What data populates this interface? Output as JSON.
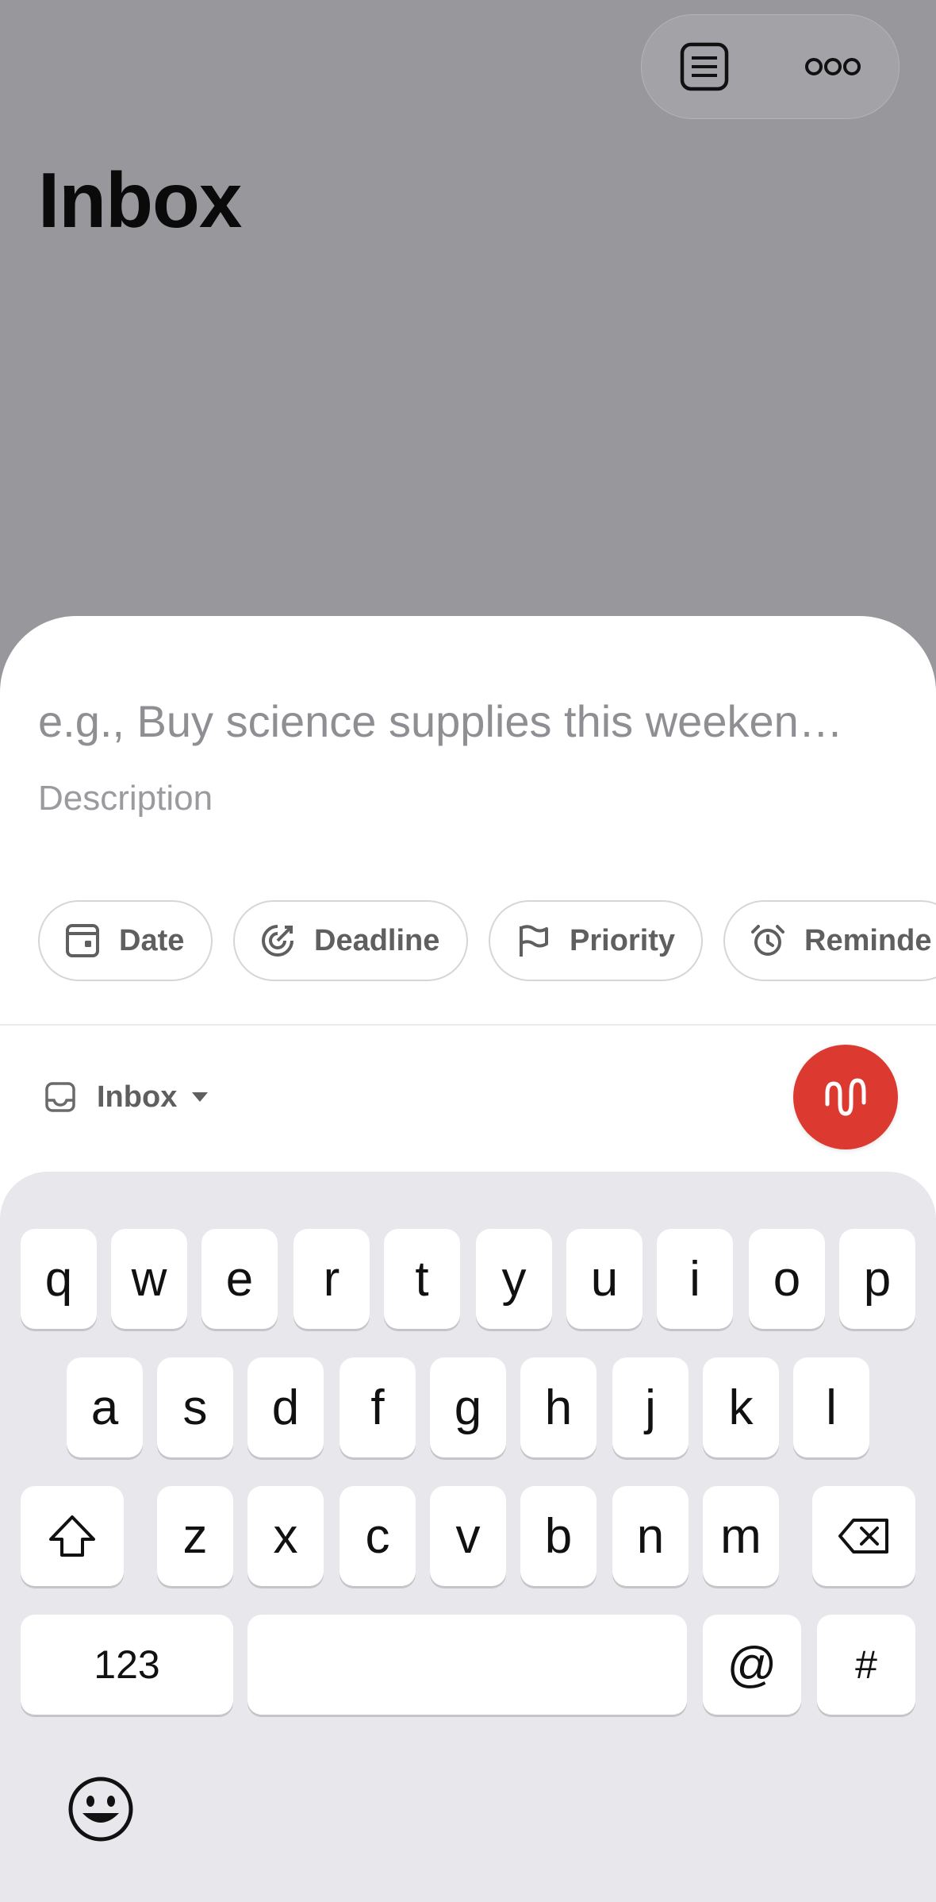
{
  "header": {
    "title": "Inbox",
    "list_icon": "list-view-icon",
    "more_icon": "more-dots-icon"
  },
  "task_form": {
    "title_placeholder": "e.g., Buy science supplies this weeken…",
    "description_placeholder": "Description",
    "chips": [
      {
        "label": "Date",
        "icon": "calendar-icon"
      },
      {
        "label": "Deadline",
        "icon": "deadline-target-icon"
      },
      {
        "label": "Priority",
        "icon": "flag-icon"
      },
      {
        "label": "Reminde",
        "icon": "alarm-clock-icon"
      }
    ],
    "project": {
      "label": "Inbox",
      "icon": "inbox-tray-icon"
    },
    "voice_button_color": "#dc3a30"
  },
  "keyboard": {
    "row1": [
      "q",
      "w",
      "e",
      "r",
      "t",
      "y",
      "u",
      "i",
      "o",
      "p"
    ],
    "row2": [
      "a",
      "s",
      "d",
      "f",
      "g",
      "h",
      "j",
      "k",
      "l"
    ],
    "row3": [
      "z",
      "x",
      "c",
      "v",
      "b",
      "n",
      "m"
    ],
    "numbers_key": "123",
    "at_key": "@",
    "hash_key": "#"
  }
}
